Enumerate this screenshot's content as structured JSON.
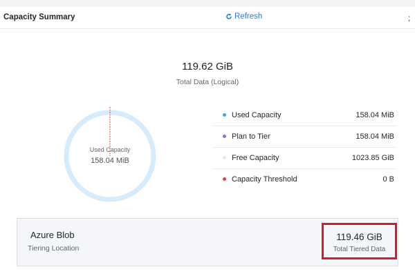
{
  "header": {
    "title": "Capacity Summary",
    "refresh_label": "Refresh",
    "more_glyph": ";"
  },
  "summary": {
    "total_value": "119.62 GiB",
    "total_label": "Total Data (Logical)"
  },
  "donut": {
    "label": "Used Capacity",
    "value": "158.04 MiB",
    "ring_color": "#d6ebfb",
    "threshold_color": "#e23b2e"
  },
  "legend": [
    {
      "name": "Used Capacity",
      "value": "158.04 MiB",
      "color": "#3aa5e6"
    },
    {
      "name": "Plan to Tier",
      "value": "158.04 MiB",
      "color": "#8f6fd9"
    },
    {
      "name": "Free Capacity",
      "value": "1023.85 GiB",
      "color": "#dcecf8"
    },
    {
      "name": "Capacity Threshold",
      "value": "0 B",
      "color": "#e0462a"
    }
  ],
  "tiering": {
    "name": "Azure Blob",
    "sublabel": "Tiering Location",
    "value": "119.46 GiB",
    "value_label": "Total Tiered Data",
    "highlight_color": "#d9182a"
  }
}
